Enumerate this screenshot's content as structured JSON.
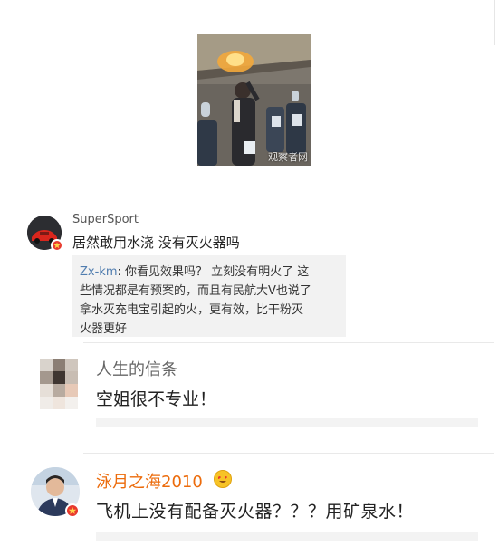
{
  "post_image": {
    "watermark": "观察者网"
  },
  "comments": [
    {
      "username": "SuperSport",
      "text": "居然敢用水浇 没有灭火器吗",
      "verified": true,
      "reply": {
        "username": "Zx-km",
        "separator": ": ",
        "text_lines": [
          "你看见效果吗？ 立刻没有明火了 这",
          "些情况都是有预案的，而且有民航大V也说了",
          "拿水灭充电宝引起的火，更有效，比干粉灭",
          "火器更好"
        ]
      }
    },
    {
      "username": "人生的信条",
      "text": "空姐很不专业！",
      "verified": false
    },
    {
      "username": "泳月之海2010",
      "text": "飞机上没有配备灭火器？？？用矿泉水！",
      "verified": true,
      "username_color": "#ec6b0b",
      "emoji": "smiling-face-with-heart-eyes-icon"
    }
  ],
  "colors": {
    "link_blue": "#507daf",
    "vip_orange": "#ec6b0b",
    "verified_red": "#e8392f",
    "reply_bg": "#f2f2f2"
  }
}
